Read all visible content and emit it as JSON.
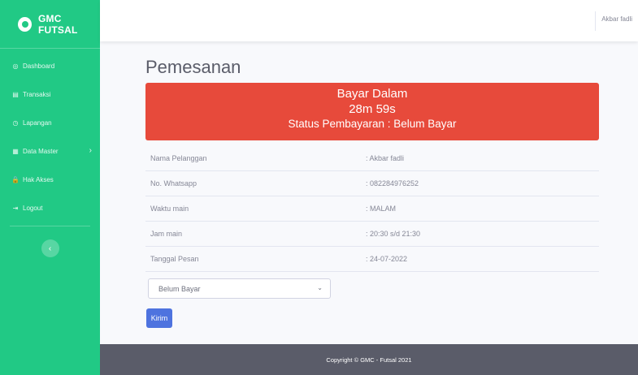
{
  "brand": {
    "name": "GMC FUTSAL",
    "icon": "soccer-ball-icon"
  },
  "sidebar": {
    "items": [
      {
        "label": "Dashboard",
        "icon": "dashboard-icon",
        "glyph": "◎"
      },
      {
        "label": "Transaksi",
        "icon": "table-icon",
        "glyph": "▤"
      },
      {
        "label": "Lapangan",
        "icon": "clock-icon",
        "glyph": "◷"
      },
      {
        "label": "Data Master",
        "icon": "grid-icon",
        "glyph": "▦",
        "has_submenu": true
      },
      {
        "label": "Hak Akses",
        "icon": "lock-icon",
        "glyph": "🔒"
      },
      {
        "label": "Logout",
        "icon": "logout-icon",
        "glyph": "⇥"
      }
    ],
    "toggle_glyph": "‹",
    "submenu_glyph": "›"
  },
  "topbar": {
    "user": "Akbar fadli"
  },
  "page": {
    "title": "Pemesanan",
    "alert": {
      "line1": "Bayar Dalam",
      "countdown": "28m 59s",
      "status": "Status Pembayaran : Belum Bayar"
    },
    "details": [
      {
        "label": "Nama Pelanggan",
        "value": ": Akbar fadli"
      },
      {
        "label": "No. Whatsapp",
        "value": ": 082284976252"
      },
      {
        "label": "Waktu main",
        "value": ": MALAM"
      },
      {
        "label": "Jam main",
        "value": ": 20:30 s/d 21:30"
      },
      {
        "label": "Tanggal Pesan",
        "value": ": 24-07-2022"
      }
    ],
    "select_value": "Belum Bayar",
    "submit_label": "Kirim"
  },
  "footer": {
    "text": "Copyright © GMC - Futsal 2021"
  },
  "colors": {
    "sidebar": "#21c985",
    "alert": "#e74a3b",
    "button": "#4e73df",
    "footer": "#5a5c69"
  }
}
